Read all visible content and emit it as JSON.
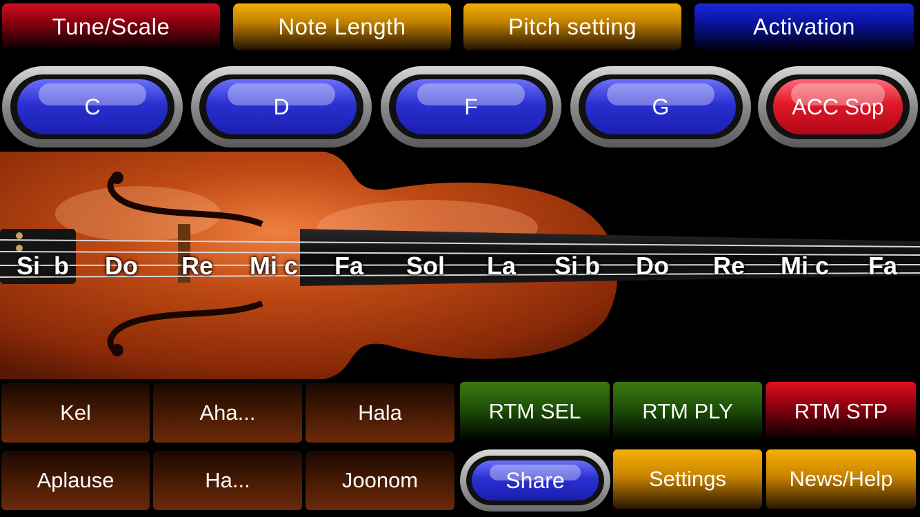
{
  "top_tabs": [
    {
      "label": "Tune/Scale"
    },
    {
      "label": "Note Length"
    },
    {
      "label": "Pitch setting"
    },
    {
      "label": "Activation"
    }
  ],
  "scale_buttons": [
    {
      "label": "C"
    },
    {
      "label": "D"
    },
    {
      "label": "F"
    },
    {
      "label": "G"
    },
    {
      "label": "ACC Sop"
    }
  ],
  "notes": [
    "Si_b",
    "Do",
    "Re",
    "Mi c",
    "Fa",
    "Sol",
    "La",
    "Si b",
    "Do",
    "Re",
    "Mi c",
    "Fa"
  ],
  "sounds": {
    "row1": [
      "Kel",
      "Aha...",
      "Hala"
    ],
    "row2": [
      "Aplause",
      "Ha...",
      "Joonom"
    ]
  },
  "rhythm": {
    "select": "RTM SEL",
    "play": "RTM PLY",
    "stop": "RTM STP"
  },
  "bottom": {
    "share": "Share",
    "settings": "Settings",
    "news_help": "News/Help"
  },
  "colors": {
    "tab_red": "#d01020",
    "tab_gold": "#f0b000",
    "tab_blue": "#1a28d8",
    "pill_blue": "#2a30d0",
    "pill_red": "#e01828",
    "violin_body": "#a83a10"
  }
}
